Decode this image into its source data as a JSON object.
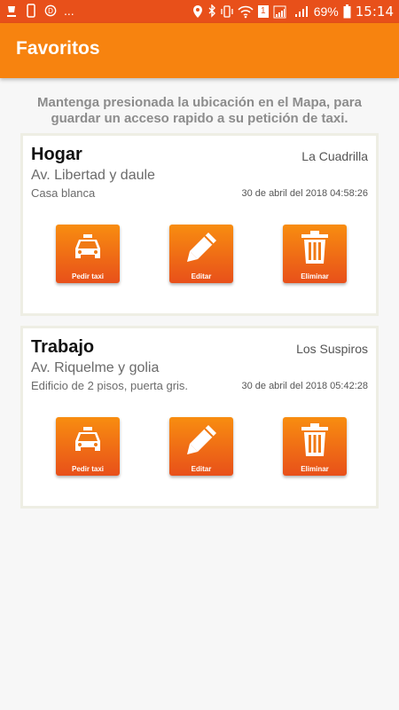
{
  "status_bar": {
    "battery": "69%",
    "time": "15:14",
    "dots": "...",
    "sim_badge": "1",
    "icons": [
      "notification-icon",
      "phone-icon",
      "app-icon",
      "location-icon",
      "bluetooth-icon",
      "vibrate-icon",
      "wifi-icon",
      "signal-icon",
      "battery-icon"
    ]
  },
  "app_bar": {
    "title": "Favoritos"
  },
  "hint": "Mantenga presionada la ubicación en el Mapa, para guardar un acceso rapido a su petición de taxi.",
  "favorites": [
    {
      "name": "Hogar",
      "zone": "La Cuadrilla",
      "address": "Av. Libertad y daule",
      "reference": "Casa blanca",
      "date": "30 de abril del 2018 04:58:26",
      "actions": [
        "Pedir taxi",
        "Editar",
        "Eliminar"
      ]
    },
    {
      "name": "Trabajo",
      "zone": "Los Suspiros",
      "address": "Av. Riquelme y golia",
      "reference": "Edificio de 2 pisos, puerta gris.",
      "date": "30 de abril del 2018 05:42:28",
      "actions": [
        "Pedir taxi",
        "Editar",
        "Eliminar"
      ]
    }
  ],
  "colors": {
    "status_bar": "#e8501a",
    "app_bar": "#f7830f",
    "button_top": "#f88d10",
    "button_bottom": "#e8501a"
  }
}
